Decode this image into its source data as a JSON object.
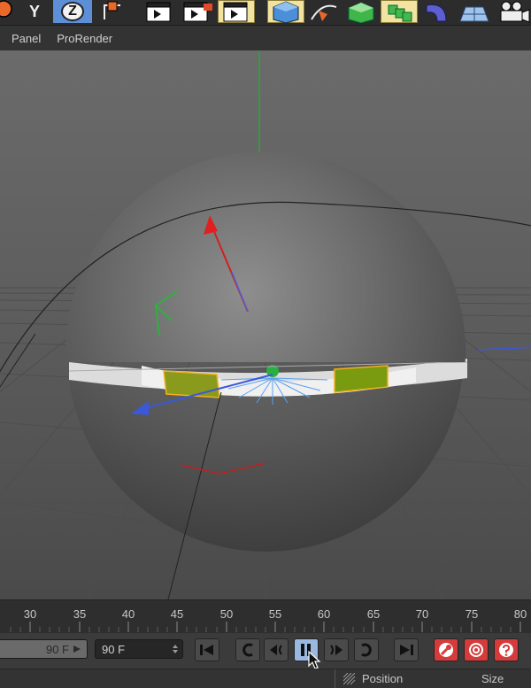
{
  "toolbar": {
    "axis_y_label": "Y",
    "axis_z_label": "Z"
  },
  "menu": {
    "items": [
      "Panel",
      "ProRender"
    ]
  },
  "timeline": {
    "frames": [
      "30",
      "35",
      "40",
      "45",
      "50",
      "55",
      "60",
      "65",
      "70",
      "75",
      "80"
    ]
  },
  "controls": {
    "end_frame_slider_value": "90 F",
    "end_frame_field_value": "90 F"
  },
  "status": {
    "position_label": "Position",
    "size_label": "Size"
  }
}
